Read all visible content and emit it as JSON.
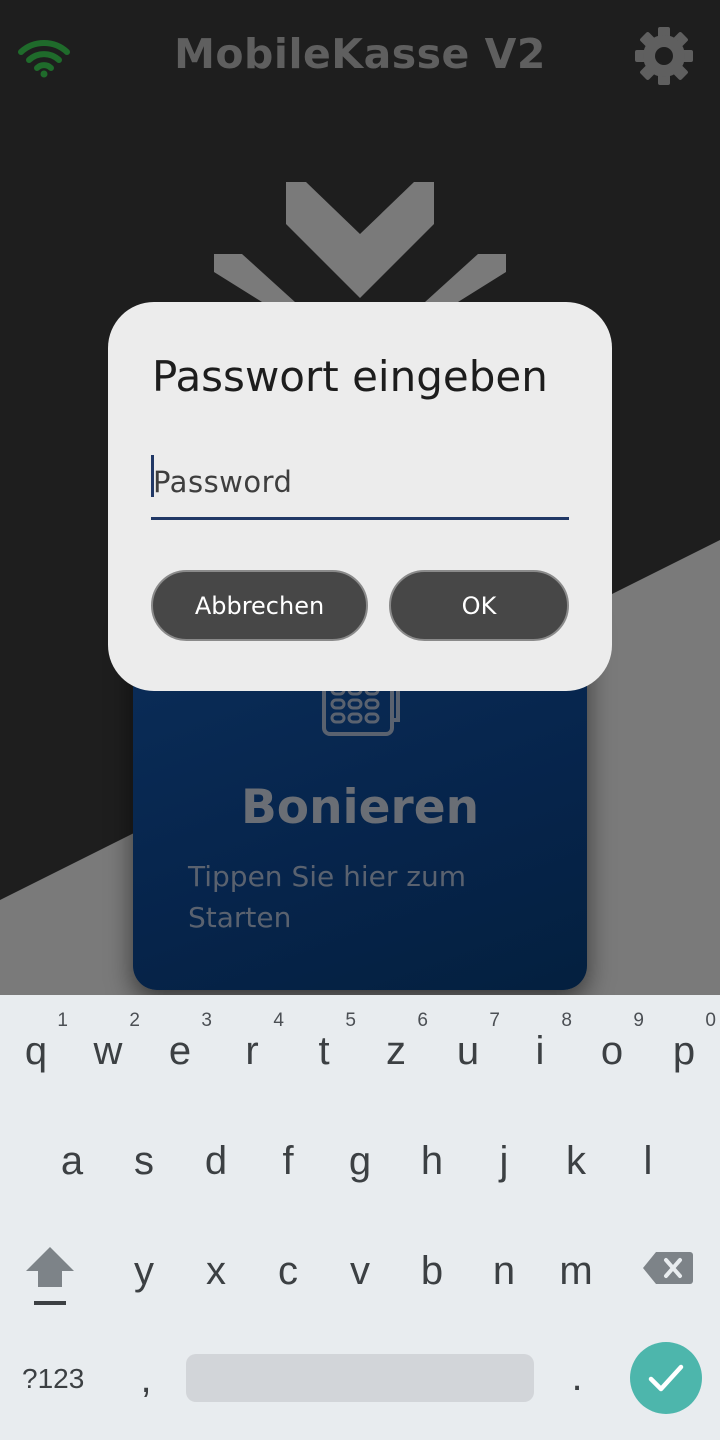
{
  "app": {
    "title": "MobileKasse V2",
    "icons": {
      "status": "wifi-icon",
      "settings": "gear-icon",
      "logo": "chevron-logo",
      "card": "card-terminal-icon"
    },
    "colors": {
      "background_dark": "#1e1e1e",
      "background_light": "#7a7a7a",
      "wifi": "#1f6b2b",
      "card_blue": "#0b2e5a"
    },
    "card": {
      "title": "Bonieren",
      "subtitle": "Tippen Sie hier zum Starten"
    }
  },
  "dialog": {
    "title": "Passwort eingeben",
    "password_value": "",
    "password_placeholder": "Password",
    "cancel_label": "Abbrechen",
    "ok_label": "OK",
    "colors": {
      "surface": "#ececec",
      "button": "#474747",
      "underline": "#213866"
    }
  },
  "keyboard": {
    "row1": [
      {
        "ch": "q",
        "hint": "1"
      },
      {
        "ch": "w",
        "hint": "2"
      },
      {
        "ch": "e",
        "hint": "3"
      },
      {
        "ch": "r",
        "hint": "4"
      },
      {
        "ch": "t",
        "hint": "5"
      },
      {
        "ch": "z",
        "hint": "6"
      },
      {
        "ch": "u",
        "hint": "7"
      },
      {
        "ch": "i",
        "hint": "8"
      },
      {
        "ch": "o",
        "hint": "9"
      },
      {
        "ch": "p",
        "hint": "0"
      }
    ],
    "row2": [
      "a",
      "s",
      "d",
      "f",
      "g",
      "h",
      "j",
      "k",
      "l"
    ],
    "row3": [
      "y",
      "x",
      "c",
      "v",
      "b",
      "n",
      "m"
    ],
    "symbols_label": "?123",
    "comma": ",",
    "period": ".",
    "icons": {
      "shift": "shift-icon",
      "backspace": "backspace-icon",
      "enter": "checkmark-icon"
    },
    "colors": {
      "background": "#e8ecef",
      "enter": "#4db6ac"
    }
  }
}
